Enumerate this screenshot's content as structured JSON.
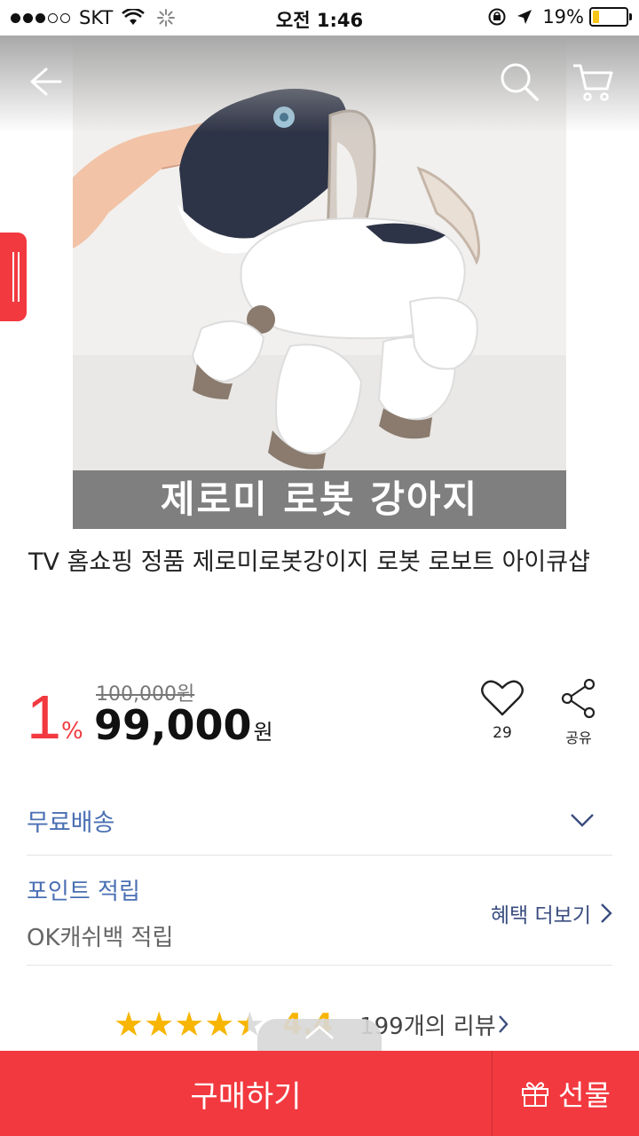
{
  "status_bar": {
    "carrier": "SKT",
    "time": "오전 1:46",
    "battery": "19%",
    "battery_level": 0.19,
    "battery_color": "#f5c518"
  },
  "header": {
    "back_icon": "arrow-left-icon",
    "search_icon": "search-icon",
    "cart_icon": "cart-icon"
  },
  "product": {
    "image_caption": "제로미 로봇 강아지",
    "title": "TV 홈쇼핑 정품 제로미로봇강이지 로봇 로보트 아이큐샵",
    "discount": "1",
    "discount_unit": "%",
    "original_price": "100,000원",
    "sale_price": "99,000",
    "currency": "원",
    "like_count": "29",
    "share_label": "공유"
  },
  "benefits": {
    "shipping": "무료배송",
    "point": "포인트 적립",
    "ok_cashbag": "OK캐쉬백 적립",
    "more": "혜택 더보기"
  },
  "rating": {
    "score": "4.4",
    "stars_value": 4.4,
    "review_count": "199개의 리뷰"
  },
  "bottom": {
    "buy": "구매하기",
    "gift": "선물"
  },
  "colors": {
    "accent": "#f2393f",
    "link_blue": "#4a6fb3",
    "star": "#f7b500"
  }
}
